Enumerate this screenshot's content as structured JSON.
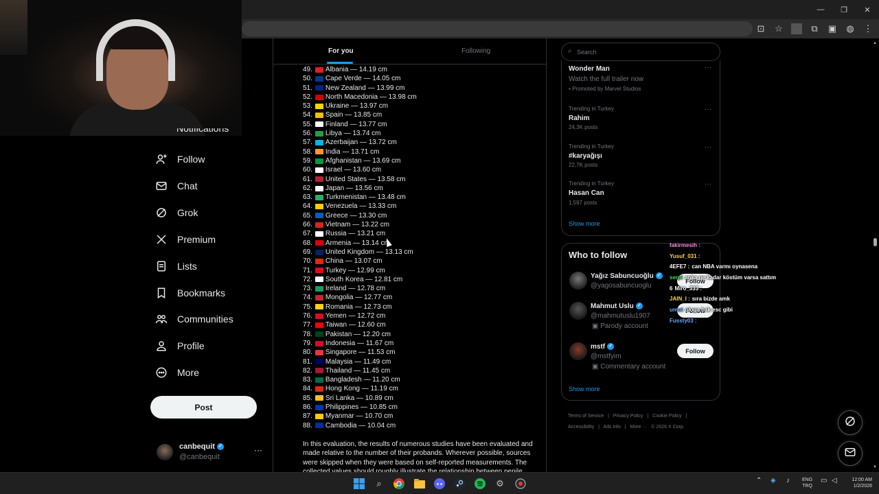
{
  "browser": {
    "window_controls": [
      "—",
      "❐",
      "✕"
    ]
  },
  "nav": {
    "partial_item": "Notifications",
    "items": [
      {
        "label": "Follow",
        "icon": "person-plus-icon"
      },
      {
        "label": "Chat",
        "icon": "mail-icon"
      },
      {
        "label": "Grok",
        "icon": "grok-icon"
      },
      {
        "label": "Premium",
        "icon": "x-logo-icon"
      },
      {
        "label": "Lists",
        "icon": "list-icon"
      },
      {
        "label": "Bookmarks",
        "icon": "bookmark-icon"
      },
      {
        "label": "Communities",
        "icon": "communities-icon"
      },
      {
        "label": "Profile",
        "icon": "profile-icon"
      },
      {
        "label": "More",
        "icon": "more-circle-icon"
      }
    ],
    "post_label": "Post"
  },
  "account": {
    "name": "canbequit",
    "handle": "@canbequit",
    "more": "···"
  },
  "timeline": {
    "tabs": {
      "active": "For you",
      "inactive": "Following"
    },
    "rows": [
      {
        "rank": "49.",
        "country": "Albania — 14.19 cm",
        "flag": "#e41e20"
      },
      {
        "rank": "50.",
        "country": "Cape Verde — 14.05 cm",
        "flag": "#003893"
      },
      {
        "rank": "51.",
        "country": "New Zealand — 13.99 cm",
        "flag": "#00247d"
      },
      {
        "rank": "52.",
        "country": "North Macedonia — 13.98 cm",
        "flag": "#d20000"
      },
      {
        "rank": "53.",
        "country": "Ukraine — 13.97 cm",
        "flag": "#ffd500"
      },
      {
        "rank": "54.",
        "country": "Spain — 13.85 cm",
        "flag": "#f1bf00"
      },
      {
        "rank": "55.",
        "country": "Finland — 13.77 cm",
        "flag": "#ffffff"
      },
      {
        "rank": "56.",
        "country": "Libya — 13.74 cm",
        "flag": "#239e46"
      },
      {
        "rank": "57.",
        "country": "Azerbaijan — 13.72 cm",
        "flag": "#00b5e2"
      },
      {
        "rank": "58.",
        "country": "India — 13.71 cm",
        "flag": "#ff9933"
      },
      {
        "rank": "59.",
        "country": "Afghanistan — 13.69 cm",
        "flag": "#009a44"
      },
      {
        "rank": "60.",
        "country": "Israel — 13.60 cm",
        "flag": "#ffffff"
      },
      {
        "rank": "61.",
        "country": "United States — 13.58 cm",
        "flag": "#b22234"
      },
      {
        "rank": "62.",
        "country": "Japan — 13.56 cm",
        "flag": "#ffffff"
      },
      {
        "rank": "63.",
        "country": "Turkmenistan — 13.48 cm",
        "flag": "#28ae66"
      },
      {
        "rank": "64.",
        "country": "Venezuela — 13.33 cm",
        "flag": "#ffcc00"
      },
      {
        "rank": "65.",
        "country": "Greece — 13.30 cm",
        "flag": "#0d5eaf"
      },
      {
        "rank": "66.",
        "country": "Vietnam — 13.22 cm",
        "flag": "#da251d"
      },
      {
        "rank": "67.",
        "country": "Russia — 13.21 cm",
        "flag": "#ffffff"
      },
      {
        "rank": "68.",
        "country": "Armenia — 13.14 cm",
        "flag": "#d90012"
      },
      {
        "rank": "69.",
        "country": "United Kingdom — 13.13 cm",
        "flag": "#012169"
      },
      {
        "rank": "70.",
        "country": "China — 13.07 cm",
        "flag": "#de2910"
      },
      {
        "rank": "71.",
        "country": "Turkey — 12.99 cm",
        "flag": "#e30a17"
      },
      {
        "rank": "72.",
        "country": "South Korea — 12.81 cm",
        "flag": "#ffffff"
      },
      {
        "rank": "73.",
        "country": "Ireland — 12.78 cm",
        "flag": "#169b62"
      },
      {
        "rank": "74.",
        "country": "Mongolia — 12.77 cm",
        "flag": "#c4272f"
      },
      {
        "rank": "75.",
        "country": "Romania — 12.73 cm",
        "flag": "#fcd116"
      },
      {
        "rank": "76.",
        "country": "Yemen — 12.72 cm",
        "flag": "#ce1126"
      },
      {
        "rank": "77.",
        "country": "Taiwan — 12.60 cm",
        "flag": "#fe0000"
      },
      {
        "rank": "78.",
        "country": "Pakistan — 12.20 cm",
        "flag": "#01411c"
      },
      {
        "rank": "79.",
        "country": "Indonesia — 11.67 cm",
        "flag": "#ce1126"
      },
      {
        "rank": "80.",
        "country": "Singapore — 11.53 cm",
        "flag": "#ef3340"
      },
      {
        "rank": "81.",
        "country": "Malaysia — 11.49 cm",
        "flag": "#010066"
      },
      {
        "rank": "82.",
        "country": "Thailand — 11.45 cm",
        "flag": "#a51931"
      },
      {
        "rank": "83.",
        "country": "Bangladesh — 11.20 cm",
        "flag": "#006a4e"
      },
      {
        "rank": "84.",
        "country": "Hong Kong — 11.19 cm",
        "flag": "#de2910"
      },
      {
        "rank": "85.",
        "country": "Sri Lanka — 10.89 cm",
        "flag": "#ffbe29"
      },
      {
        "rank": "86.",
        "country": "Philippines — 10.85 cm",
        "flag": "#0038a8"
      },
      {
        "rank": "87.",
        "country": "Myanmar — 10.70 cm",
        "flag": "#fecb00"
      },
      {
        "rank": "88.",
        "country": "Cambodia — 10.04 cm",
        "flag": "#032ea1"
      }
    ],
    "paragraph": "In this evaluation, the results of numerous studies have been evaluated and made relative to the number of their probands. Wherever possible, sources were skipped when they were based on self-reported measurements. The collected values should roughly illustrate the relationship between penile"
  },
  "search": {
    "placeholder": "Search"
  },
  "trends": {
    "promo": {
      "title": "Wonder Man",
      "sub": "Watch the full trailer now",
      "promoted": "Promoted by Marvel Studios"
    },
    "items": [
      {
        "context": "Trending in Turkey",
        "title": "Rahim",
        "posts": "24,3K posts"
      },
      {
        "context": "Trending in Turkey",
        "title": "#karyağışı",
        "posts": "22,7K posts"
      },
      {
        "context": "Trending in Turkey",
        "title": "Hasan Can",
        "posts": "1,597 posts"
      }
    ],
    "show_more": "Show more"
  },
  "who_to_follow": {
    "title": "Who to follow",
    "accounts": [
      {
        "name": "Yağız Sabuncuoğlu",
        "handle": "@yagosabuncuoglu",
        "badge": "",
        "follow": "Follow"
      },
      {
        "name": "Mahmut Uslu",
        "handle": "@mahmutuslu1907",
        "badge": "Parody account",
        "follow": "Follow"
      },
      {
        "name": "mstf",
        "handle": "@mstfyim",
        "badge": "Commentary account",
        "follow": "Follow"
      }
    ],
    "show_more": "Show more"
  },
  "footer": {
    "links": [
      "Terms of Service",
      "|",
      "Privacy Policy",
      "|",
      "Cookie Policy",
      "|",
      "Accessibility",
      "|",
      "Ads info",
      "|",
      "More ···",
      "© 2026 X Corp."
    ]
  },
  "chat_overlay": [
    {
      "user": "fakirmesih :",
      "msg": "",
      "color": "#ff8ad8"
    },
    {
      "user": "Yusuf_031 :",
      "msg": "",
      "color": "#ffd24d"
    },
    {
      "user": "4EFE7 :",
      "msg": "can NBA varmı oynasena",
      "color": "#ffffff"
    },
    {
      "user": "serpi",
      "msg": "anka ne kadar köstüm varsa sattım",
      "color": "#48d35a"
    },
    {
      "user": "6",
      "msg": "Miro_333 :",
      "color": "#ffffff"
    },
    {
      "user": "JAIN_I :",
      "msg": "sıra bizde amk",
      "color": "#ffd24d"
    },
    {
      "user": "umut",
      "msg": "ologa bak esc gibi",
      "color": "#6aa8ff"
    },
    {
      "user": "Fussty03 :",
      "msg": "",
      "color": "#6aa8ff"
    }
  ],
  "taskbar": {
    "apps": [
      "windows-start-icon",
      "search-icon",
      "chrome-icon",
      "file-explorer-icon",
      "discord-icon",
      "steam-icon",
      "spotify-icon",
      "settings-icon",
      "recorder-icon"
    ],
    "lang_top": "ENG",
    "lang_bottom": "TRQ",
    "time": "12:00 AM",
    "date": "1/2/2026"
  },
  "colors": {
    "accent": "#1d9bf0",
    "background": "#000000",
    "border": "#2f3336",
    "muted": "#71767b"
  }
}
